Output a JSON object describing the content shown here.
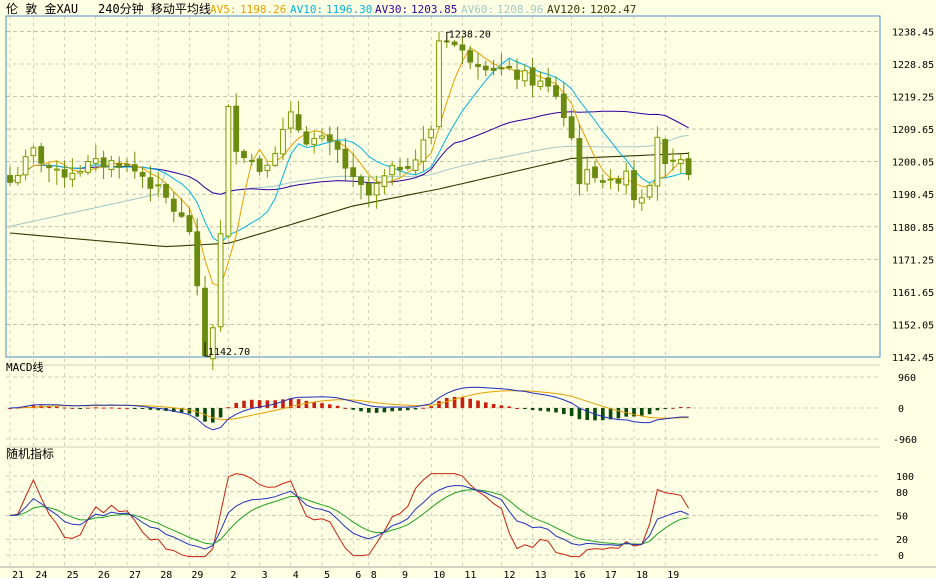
{
  "header": {
    "market": "伦 敦 金XAU",
    "period_label": "240分钟 移动平均线",
    "averages": [
      {
        "label": "AV5:",
        "value": "1198.26",
        "color": "#e6a000"
      },
      {
        "label": "AV10:",
        "value": "1196.30",
        "color": "#00b4e6"
      },
      {
        "label": "AV30:",
        "value": "1203.85",
        "color": "#3000a0"
      },
      {
        "label": "AV60:",
        "value": "1208.96",
        "color": "#a0c8c8"
      },
      {
        "label": "AV120:",
        "value": "1202.47",
        "color": "#2e3a00"
      }
    ]
  },
  "colors": {
    "background": "#ffffe3",
    "panel_border": "#4a90c8",
    "grid": "#9aa090",
    "candle": "#7a9a00",
    "candle_down": "#6a8a10",
    "macd_up": "#c82010",
    "macd_down": "#0a4a0a",
    "dif": "#2030c0",
    "dea": "#e6a000",
    "k_line": "#c82010",
    "d_line": "#2030c0",
    "j_line": "#20a020"
  },
  "chart_data": [
    {
      "type": "candlestick",
      "name": "main",
      "title": "240分钟 移动平均线",
      "ylim": [
        1142.45,
        1243
      ],
      "yticks": [
        "1238.45",
        "1228.85",
        "1219.25",
        "1209.65",
        "1200.05",
        "1190.45",
        "1180.85",
        "1171.25",
        "1161.65",
        "1152.05",
        "1142.45"
      ],
      "annotations": [
        {
          "text": "1238.20",
          "value": 1238.2,
          "index": 56,
          "kind": "high"
        },
        {
          "text": "1142.70",
          "value": 1142.7,
          "index": 25,
          "kind": "low"
        }
      ],
      "last_values": {
        "AV5": 1198.26,
        "AV10": 1196.3,
        "AV30": 1203.85,
        "AV60": 1208.96,
        "AV120": 1202.47
      }
    },
    {
      "type": "bar",
      "name": "macd",
      "title": "MACD线",
      "yticks": [
        "960",
        "0",
        "-960"
      ],
      "ylim": [
        -1100,
        1100
      ]
    },
    {
      "type": "line",
      "name": "kdj",
      "title": "随机指标",
      "yticks": [
        "100",
        "80",
        "50",
        "20",
        "0"
      ],
      "ylim": [
        -5,
        105
      ]
    }
  ],
  "x_axis": {
    "labels": [
      {
        "text": "21",
        "index": 0
      },
      {
        "text": "24",
        "index": 3
      },
      {
        "text": "25",
        "index": 7
      },
      {
        "text": "26",
        "index": 11
      },
      {
        "text": "27",
        "index": 15
      },
      {
        "text": "28",
        "index": 19
      },
      {
        "text": "29",
        "index": 23
      },
      {
        "text": "2",
        "index": 28
      },
      {
        "text": "3",
        "index": 32
      },
      {
        "text": "4",
        "index": 36
      },
      {
        "text": "5",
        "index": 40
      },
      {
        "text": "6",
        "index": 44
      },
      {
        "text": "8",
        "index": 46
      },
      {
        "text": "9",
        "index": 50
      },
      {
        "text": "10",
        "index": 54
      },
      {
        "text": "11",
        "index": 58
      },
      {
        "text": "12",
        "index": 63
      },
      {
        "text": "13",
        "index": 67
      },
      {
        "text": "16",
        "index": 72
      },
      {
        "text": "17",
        "index": 76
      },
      {
        "text": "18",
        "index": 80
      },
      {
        "text": "19",
        "index": 84
      }
    ]
  }
}
